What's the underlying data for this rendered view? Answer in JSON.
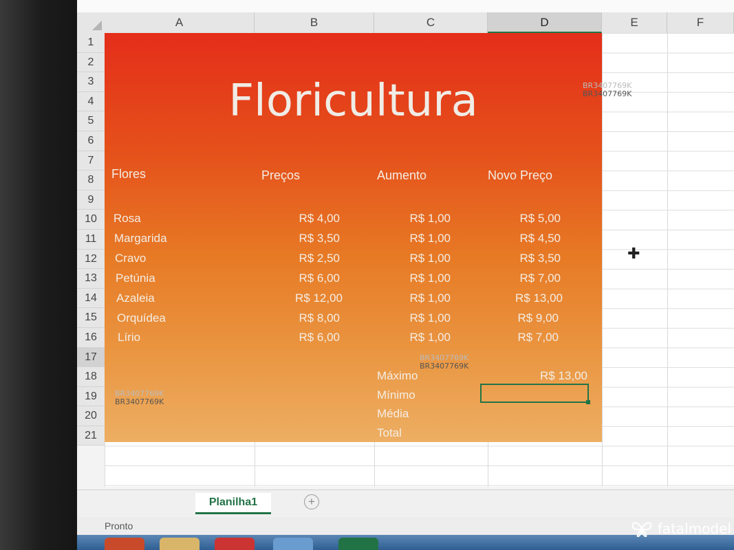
{
  "spreadsheet": {
    "columns": [
      "A",
      "B",
      "C",
      "D",
      "E",
      "F"
    ],
    "rows": [
      "1",
      "2",
      "3",
      "4",
      "5",
      "6",
      "7",
      "8",
      "9",
      "10",
      "11",
      "12",
      "13",
      "14",
      "15",
      "16",
      "17",
      "18",
      "19",
      "20",
      "21"
    ],
    "selected_column": "D",
    "selected_row": "17",
    "title": "Floricultura",
    "headers": {
      "flores": "Flores",
      "precos": "Preços",
      "aumento": "Aumento",
      "novo_preco": "Novo Preço"
    },
    "items": [
      {
        "flor": "Rosa",
        "preco": "R$ 4,00",
        "aumento": "R$ 1,00",
        "novo": "R$ 5,00"
      },
      {
        "flor": "Margarida",
        "preco": "R$ 3,50",
        "aumento": "R$ 1,00",
        "novo": "R$ 4,50"
      },
      {
        "flor": "Cravo",
        "preco": "R$ 2,50",
        "aumento": "R$ 1,00",
        "novo": "R$ 3,50"
      },
      {
        "flor": "Petúnia",
        "preco": "R$ 6,00",
        "aumento": "R$ 1,00",
        "novo": "R$ 7,00"
      },
      {
        "flor": "Azaleia",
        "preco": "R$ 12,00",
        "aumento": "R$ 1,00",
        "novo": "R$ 13,00"
      },
      {
        "flor": "Orquídea",
        "preco": "R$ 8,00",
        "aumento": "R$ 1,00",
        "novo": "R$ 9,00"
      },
      {
        "flor": "Lírio",
        "preco": "R$ 6,00",
        "aumento": "R$ 1,00",
        "novo": "R$ 7,00"
      }
    ],
    "summary": [
      {
        "label": "Máximo",
        "value": "R$ 13,00"
      },
      {
        "label": "Mínimo",
        "value": ""
      },
      {
        "label": "Média",
        "value": ""
      },
      {
        "label": "Total",
        "value": ""
      }
    ]
  },
  "watermark": "BR3407769K",
  "sheet_tab": "Planilha1",
  "add_sheet_symbol": "+",
  "status": "Pronto",
  "brand": "fatalmodel",
  "colors": {
    "accent": "#217346",
    "header_top": "#e42e1a",
    "header_bottom": "#edae63"
  }
}
